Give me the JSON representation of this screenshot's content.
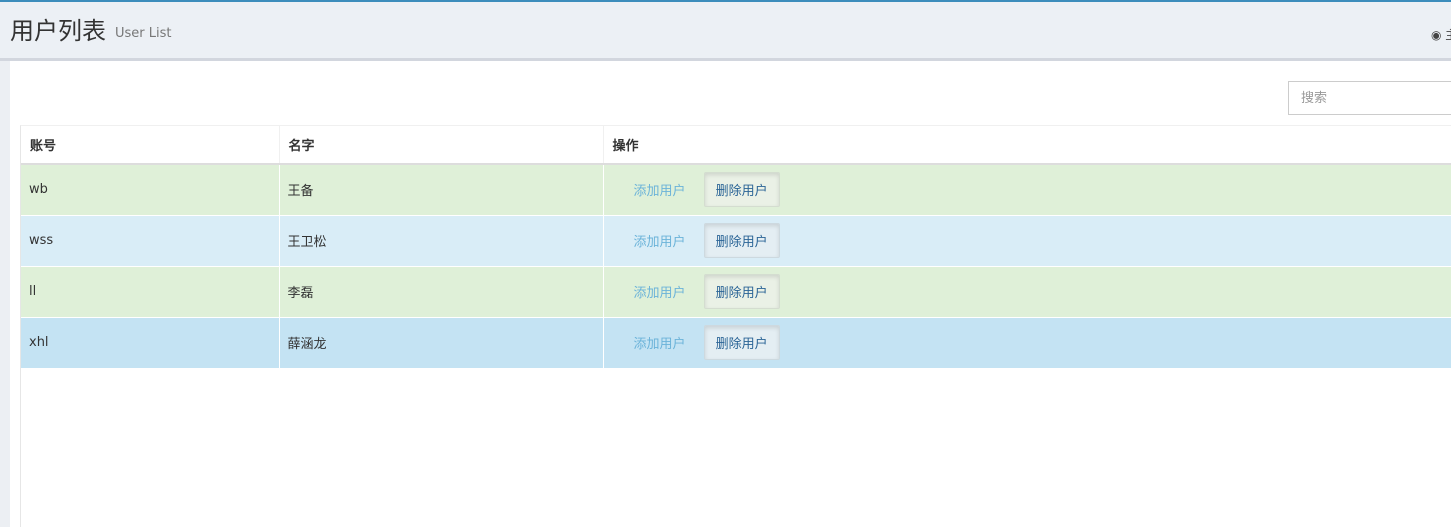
{
  "header": {
    "title": "用户列表",
    "subtitle": "User List",
    "dashboard_icon": "dashboard-icon",
    "dashboard_label": "主"
  },
  "search": {
    "placeholder": "搜索",
    "value": ""
  },
  "table": {
    "columns": [
      "账号",
      "名字",
      "操作"
    ],
    "rows": [
      {
        "account": "wb",
        "name": "王备",
        "add_label": "添加用户",
        "delete_label": "删除用户",
        "style": "success"
      },
      {
        "account": "wss",
        "name": "王卫松",
        "add_label": "添加用户",
        "delete_label": "删除用户",
        "style": "info"
      },
      {
        "account": "ll",
        "name": "李磊",
        "add_label": "添加用户",
        "delete_label": "删除用户",
        "style": "success"
      },
      {
        "account": "xhl",
        "name": "薛涵龙",
        "add_label": "添加用户",
        "delete_label": "删除用户",
        "style": "info-active"
      }
    ]
  },
  "colors": {
    "accent": "#3c8dbc",
    "success_row": "#dff0d8",
    "info_row": "#d9edf7",
    "info_active_row": "#c4e3f3"
  }
}
